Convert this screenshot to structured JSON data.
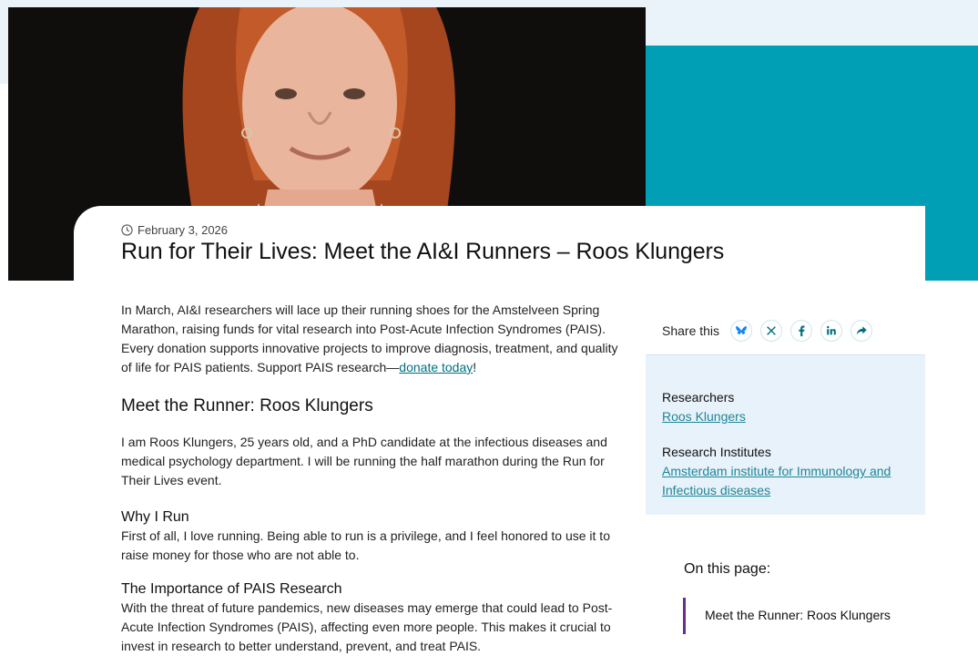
{
  "article": {
    "date": "February 3, 2026",
    "title": "Run for Their Lives: Meet the AI&I Runners – Roos Klungers",
    "intro_text": "In March, AI&I researchers will lace up their running shoes for the Amstelveen Spring Marathon, raising funds for vital research into Post-Acute Infection Syndromes (PAIS). Every donation supports innovative projects to improve diagnosis, treatment, and quality of life for PAIS patients. Support PAIS research—",
    "intro_link": "donate today",
    "intro_end": "!",
    "section_heading": "Meet the Runner: Roos Klungers",
    "section_text": "I am Roos Klungers, 25 years old, and a PhD candidate at the infectious diseases and medical psychology department. I will be running the half marathon during the Run for Their Lives event.",
    "why_heading": "Why I Run",
    "why_text": "First of all, I love running. Being able to run is a privilege, and I feel honored to use it to raise money for those who are not able to.",
    "importance_heading": "The Importance of PAIS Research",
    "importance_text": "With the threat of future pandemics, new diseases may emerge that could lead to Post-Acute Infection Syndromes (PAIS), affecting even more people. This makes it crucial to invest in research to better understand, prevent, and treat PAIS."
  },
  "share": {
    "label": "Share this",
    "buttons": [
      {
        "icon": "bluesky-icon"
      },
      {
        "icon": "x-icon"
      },
      {
        "icon": "facebook-icon"
      },
      {
        "icon": "linkedin-icon"
      },
      {
        "icon": "share-arrow-icon"
      }
    ]
  },
  "meta": {
    "researchers_label": "Researchers",
    "researcher": "Roos Klungers",
    "institutes_label": "Research Institutes",
    "institute": "Amsterdam institute for Immunology and Infectious diseases"
  },
  "toc": {
    "title": "On this page:",
    "items": [
      "Meet the Runner: Roos Klungers"
    ]
  },
  "colors": {
    "teal": "#009fb5",
    "light_band": "#eaf3fa",
    "link": "#00707f",
    "meta_link": "#1f8597",
    "toc_accent": "#6b2c8a"
  }
}
